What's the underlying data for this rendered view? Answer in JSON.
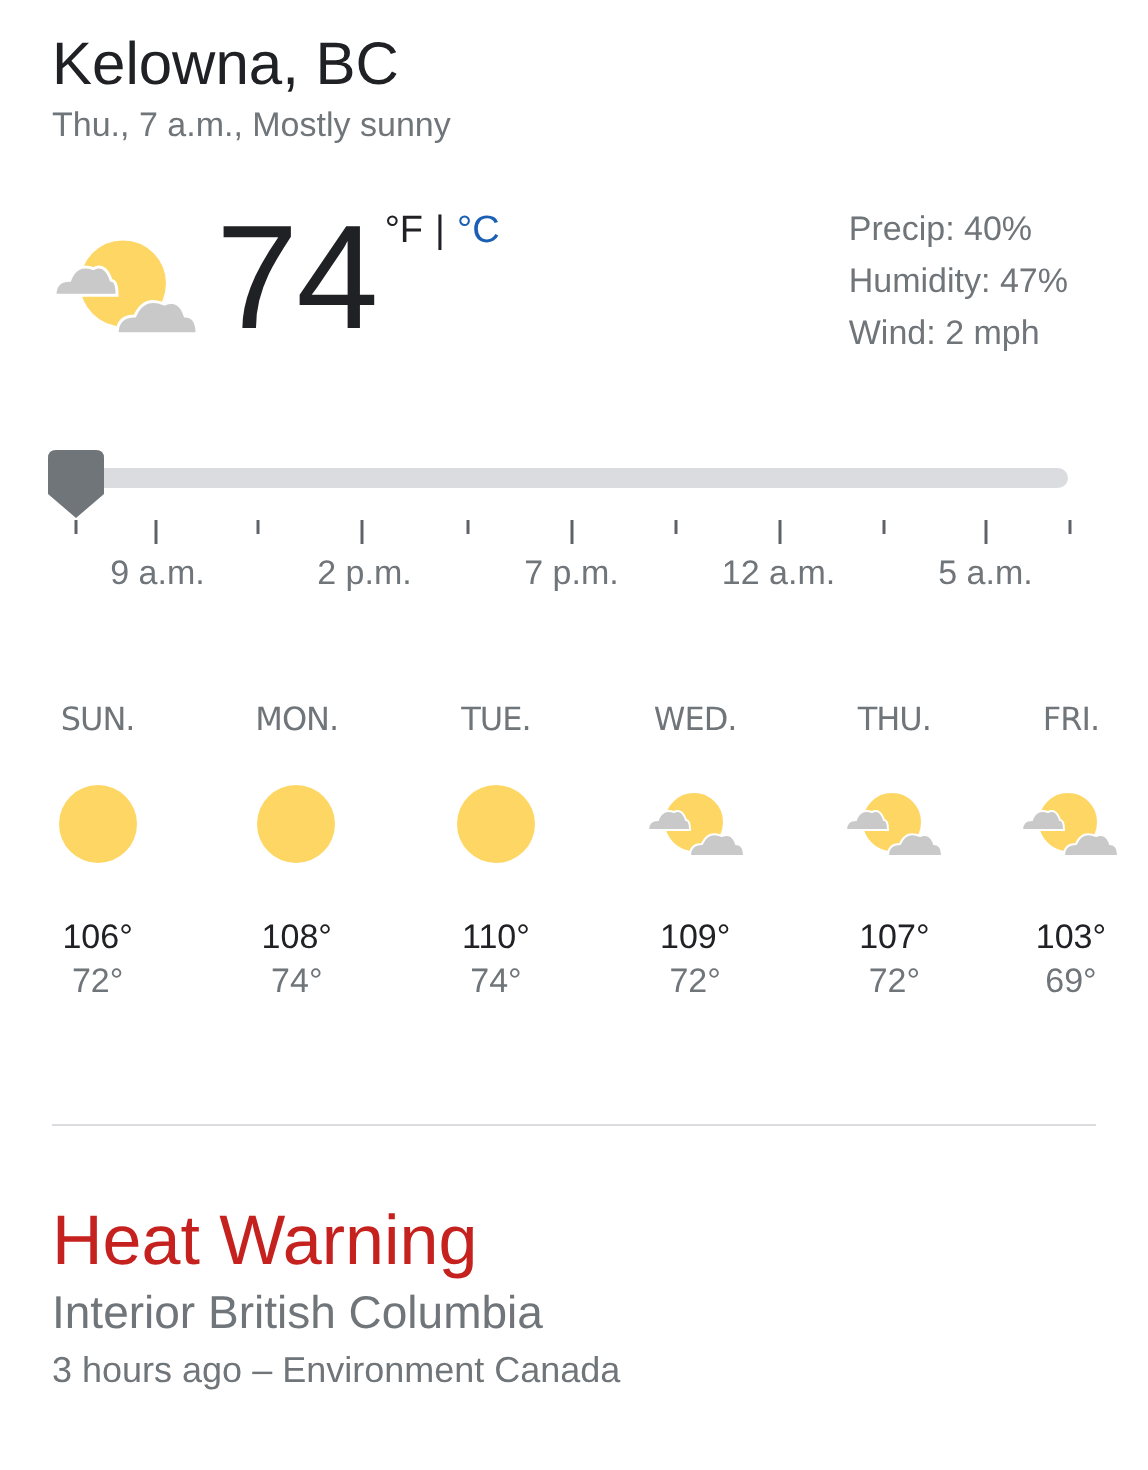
{
  "location": "Kelowna, BC",
  "subtitle": "Thu., 7 a.m., Mostly sunny",
  "current": {
    "kind": "partly_cloudy",
    "temperature": "74",
    "units": [
      {
        "label": "°F",
        "selected": true
      },
      {
        "label": "°C",
        "selected": false
      }
    ],
    "separator": "|"
  },
  "details": [
    "Precip: 40%",
    "Humidity: 47%",
    "Wind: 2 mph"
  ],
  "timeline": {
    "level": 0,
    "labels": [
      "9 a.m.",
      "2 p.m.",
      "7 p.m.",
      "12 a.m.",
      "5 a.m."
    ]
  },
  "forecast": [
    {
      "day": "SUN.",
      "kind": "sunny",
      "high": "106°",
      "low": "72°"
    },
    {
      "day": "MON.",
      "kind": "sunny",
      "high": "108°",
      "low": "74°"
    },
    {
      "day": "TUE.",
      "kind": "sunny",
      "high": "110°",
      "low": "74°"
    },
    {
      "day": "WED.",
      "kind": "partly_cloudy",
      "high": "109°",
      "low": "72°"
    },
    {
      "day": "THU.",
      "kind": "partly_cloudy",
      "high": "107°",
      "low": "72°"
    },
    {
      "day": "FRI.",
      "kind": "partly_cloudy",
      "high": "103°",
      "low": "69°"
    }
  ],
  "alert": {
    "title": "Heat Warning",
    "region": "Interior British Columbia",
    "source": "3 hours ago – Environment Canada"
  }
}
